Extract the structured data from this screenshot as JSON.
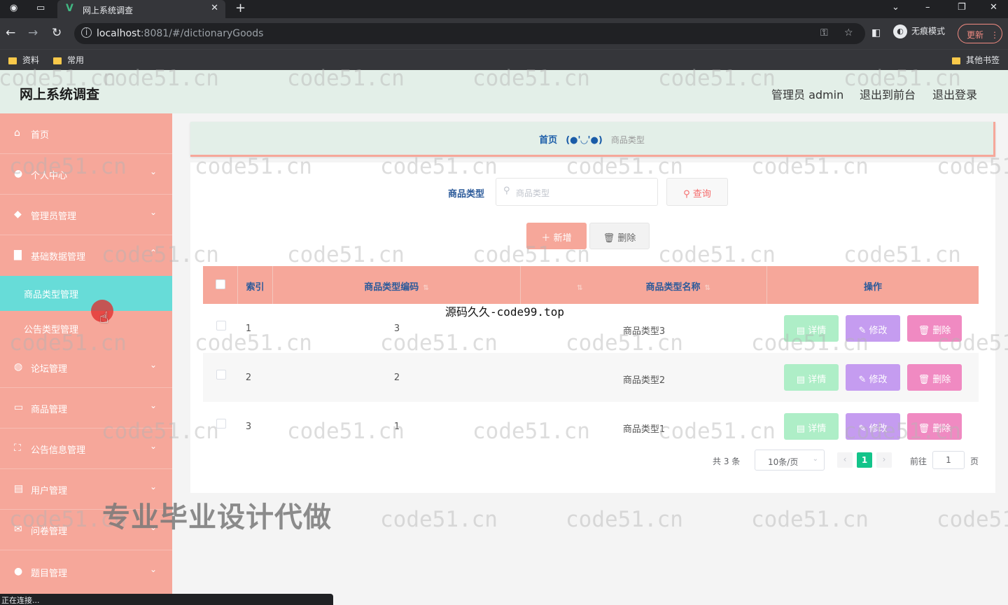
{
  "browser": {
    "tab_title": "网上系统调查",
    "url_host": "localhost",
    "url_rest": ":8081/#/dictionaryGoods",
    "incognito_label": "无痕模式",
    "update_label": "更新",
    "bookmarks": [
      "资料",
      "常用"
    ],
    "other_bookmarks": "其他书签",
    "status": "正在连接..."
  },
  "header": {
    "title": "网上系统调查",
    "admin": "管理员 admin",
    "to_front": "退出到前台",
    "logout": "退出登录"
  },
  "sidebar": {
    "items": [
      {
        "label": "首页",
        "icon": "home-icon"
      },
      {
        "label": "个人中心",
        "icon": "user-icon"
      },
      {
        "label": "管理员管理",
        "icon": "admin-icon"
      },
      {
        "label": "基础数据管理",
        "icon": "book-icon"
      },
      {
        "label": "商品类型管理",
        "icon": ""
      },
      {
        "label": "公告类型管理",
        "icon": ""
      },
      {
        "label": "论坛管理",
        "icon": "forum-icon"
      },
      {
        "label": "商品管理",
        "icon": "goods-icon"
      },
      {
        "label": "公告信息管理",
        "icon": "notice-icon"
      },
      {
        "label": "用户管理",
        "icon": "users-icon"
      },
      {
        "label": "问卷管理",
        "icon": "survey-icon"
      },
      {
        "label": "题目管理",
        "icon": "question-icon"
      }
    ]
  },
  "breadcrumb": {
    "home": "首页",
    "face": "(●'◡'●)",
    "current": "商品类型"
  },
  "search": {
    "label": "商品类型",
    "placeholder": "商品类型",
    "query_label": "查询"
  },
  "actions": {
    "add_label": "新增",
    "delete_label": "删除"
  },
  "table": {
    "headers": {
      "index": "索引",
      "code": "商品类型编码",
      "name": "商品类型名称",
      "ops": "操作"
    },
    "rows": [
      {
        "index": "1",
        "code": "3",
        "name": "商品类型3"
      },
      {
        "index": "2",
        "code": "2",
        "name": "商品类型2"
      },
      {
        "index": "3",
        "code": "1",
        "name": "商品类型1"
      }
    ],
    "op_detail": "详情",
    "op_edit": "修改",
    "op_remove": "删除"
  },
  "pagination": {
    "total": "共 3 条",
    "page_size": "10条/页",
    "current_page": "1",
    "goto_label": "前往",
    "goto_value": "1",
    "page_suffix": "页"
  },
  "overlays": {
    "watermark": "code51.cn",
    "center_mark": "源码久久-code99.top",
    "promo": "专业毕业设计代做"
  },
  "colors": {
    "accent": "#f6a79a",
    "active_sub": "#67dcd8",
    "header_bg": "#e3efe8",
    "detail": "#aeeec7",
    "edit": "#c59cf0",
    "remove": "#f08ac2"
  }
}
